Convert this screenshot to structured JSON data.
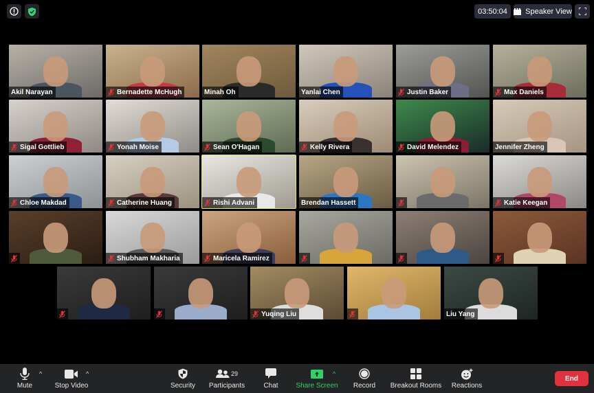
{
  "top_bar": {
    "info_icon": "info-icon",
    "security_shield_icon": "shield-check-icon",
    "timer": "03:50:04",
    "view_button": {
      "icon": "speaker-view-icon",
      "label": "Speaker View"
    },
    "fullscreen_icon": "fullscreen-icon"
  },
  "colors": {
    "active_speaker_border": "#e3e85a",
    "muted_icon": "#e0313c",
    "share_screen_green": "#2fd267",
    "end_button": "#e0323e",
    "toolbar_bg": "#232426"
  },
  "participants": [
    {
      "name": "Akil Narayan",
      "muted": false,
      "show_name": true
    },
    {
      "name": "Bernadette McHugh",
      "muted": true,
      "show_name": true
    },
    {
      "name": "Minah Oh",
      "muted": false,
      "show_name": true
    },
    {
      "name": "Yanlai Chen",
      "muted": false,
      "show_name": true
    },
    {
      "name": "Justin Baker",
      "muted": true,
      "show_name": true
    },
    {
      "name": "Max Daniels",
      "muted": true,
      "show_name": true
    },
    {
      "name": "Sigal Gottlieb",
      "muted": true,
      "show_name": true
    },
    {
      "name": "Yonah Moise",
      "muted": true,
      "show_name": true
    },
    {
      "name": "Sean O'Hagan",
      "muted": true,
      "show_name": true
    },
    {
      "name": "Kelly Rivera",
      "muted": true,
      "show_name": true
    },
    {
      "name": "David Melendez",
      "muted": true,
      "show_name": true
    },
    {
      "name": "Jennifer Zheng",
      "muted": false,
      "show_name": true
    },
    {
      "name": "Chloe Makdad",
      "muted": true,
      "show_name": true
    },
    {
      "name": "Catherine Huang",
      "muted": true,
      "show_name": true
    },
    {
      "name": "Rishi Advani",
      "muted": true,
      "show_name": true,
      "active_speaker": true
    },
    {
      "name": "Brendan Hassett",
      "muted": false,
      "show_name": true
    },
    {
      "name": "",
      "muted": true,
      "show_name": false
    },
    {
      "name": "Katie Keegan",
      "muted": true,
      "show_name": true
    },
    {
      "name": "",
      "muted": true,
      "show_name": false
    },
    {
      "name": "Shubham Makharia",
      "muted": true,
      "show_name": true
    },
    {
      "name": "Maricela Ramirez",
      "muted": true,
      "show_name": true
    },
    {
      "name": "",
      "muted": true,
      "show_name": false
    },
    {
      "name": "",
      "muted": true,
      "show_name": false
    },
    {
      "name": "",
      "muted": true,
      "show_name": false
    },
    {
      "name": "",
      "muted": true,
      "show_name": false
    },
    {
      "name": "",
      "muted": true,
      "show_name": false
    },
    {
      "name": "Yuqing Liu",
      "muted": true,
      "show_name": true
    },
    {
      "name": "",
      "muted": true,
      "show_name": false
    },
    {
      "name": "Liu Yang",
      "muted": false,
      "show_name": true
    }
  ],
  "toolbar": {
    "mute": {
      "label": "Mute",
      "icon": "microphone-icon"
    },
    "stop_video": {
      "label": "Stop Video",
      "icon": "video-camera-icon"
    },
    "security": {
      "label": "Security",
      "icon": "shield-icon"
    },
    "participants": {
      "label": "Participants",
      "icon": "participants-icon",
      "count": "29"
    },
    "chat": {
      "label": "Chat",
      "icon": "chat-bubble-icon"
    },
    "share_screen": {
      "label": "Share Screen",
      "icon": "share-screen-arrow-icon"
    },
    "record": {
      "label": "Record",
      "icon": "record-icon"
    },
    "breakout_rooms": {
      "label": "Breakout Rooms",
      "icon": "grid-icon"
    },
    "reactions": {
      "label": "Reactions",
      "icon": "smiley-plus-icon"
    },
    "end": {
      "label": "End"
    },
    "caret": "^"
  }
}
